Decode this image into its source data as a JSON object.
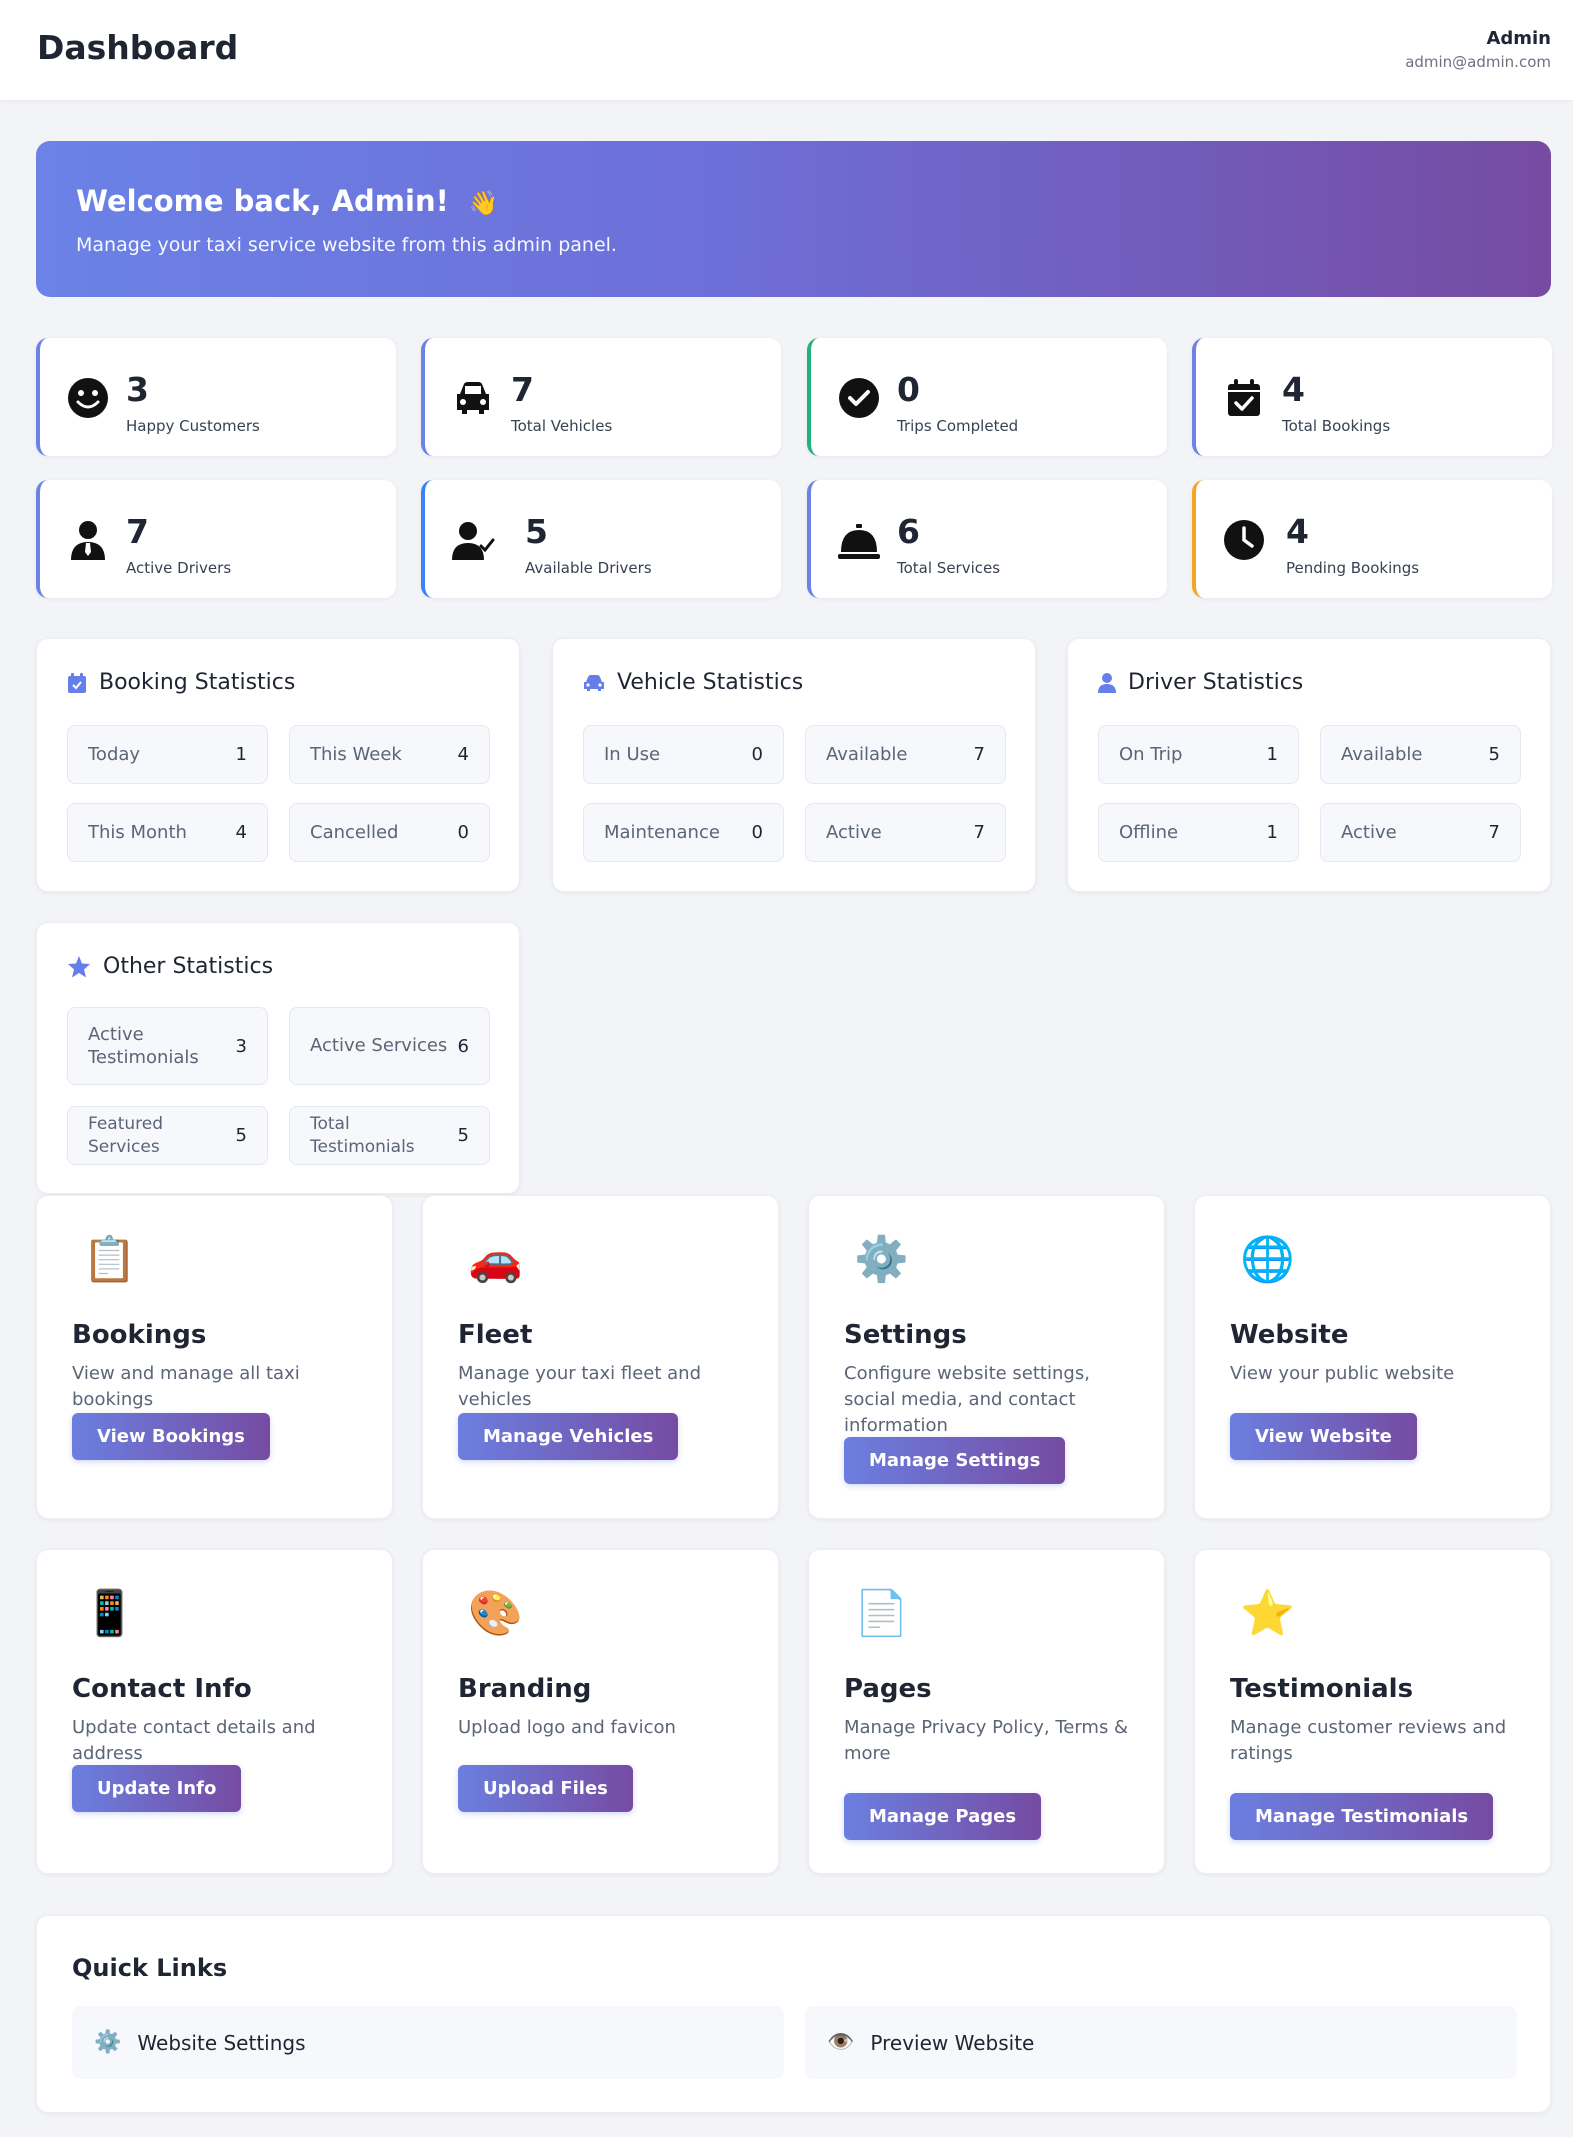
{
  "header": {
    "title": "Dashboard",
    "user_name": "Admin",
    "user_email": "admin@admin.com"
  },
  "hero": {
    "title": "Welcome back, Admin!",
    "emoji": "👋",
    "subtitle": "Manage your taxi service website from this admin panel."
  },
  "stats": [
    {
      "value": "3",
      "label": "Happy Customers",
      "icon": "smiley-icon",
      "accent": "#6b82e6"
    },
    {
      "value": "7",
      "label": "Total Vehicles",
      "icon": "car-icon",
      "accent": "#6b82e6"
    },
    {
      "value": "0",
      "label": "Trips Completed",
      "icon": "check-circle-icon",
      "accent": "#22b37a"
    },
    {
      "value": "4",
      "label": "Total Bookings",
      "icon": "calendar-check-icon",
      "accent": "#6b82e6"
    },
    {
      "value": "7",
      "label": "Active Drivers",
      "icon": "user-tie-icon",
      "accent": "#6b82e6"
    },
    {
      "value": "5",
      "label": "Available Drivers",
      "icon": "user-check-icon",
      "accent": "#3b82f6"
    },
    {
      "value": "6",
      "label": "Total Services",
      "icon": "bell-concierge-icon",
      "accent": "#6b82e6"
    },
    {
      "value": "4",
      "label": "Pending Bookings",
      "icon": "clock-icon",
      "accent": "#f5a524"
    }
  ],
  "panels": {
    "booking": {
      "title": "Booking Statistics",
      "icon": "calendar-check-icon",
      "cells": [
        {
          "k": "Today",
          "v": "1"
        },
        {
          "k": "This Week",
          "v": "4"
        },
        {
          "k": "This Month",
          "v": "4"
        },
        {
          "k": "Cancelled",
          "v": "0"
        }
      ]
    },
    "vehicle": {
      "title": "Vehicle Statistics",
      "icon": "car-icon",
      "cells": [
        {
          "k": "In Use",
          "v": "0"
        },
        {
          "k": "Available",
          "v": "7"
        },
        {
          "k": "Maintenance",
          "v": "0"
        },
        {
          "k": "Active",
          "v": "7"
        }
      ]
    },
    "driver": {
      "title": "Driver Statistics",
      "icon": "user-icon",
      "cells": [
        {
          "k": "On Trip",
          "v": "1"
        },
        {
          "k": "Available",
          "v": "5"
        },
        {
          "k": "Offline",
          "v": "1"
        },
        {
          "k": "Active",
          "v": "7"
        }
      ]
    },
    "other": {
      "title": "Other Statistics",
      "icon": "star-icon",
      "cells": [
        {
          "k": "Active Testimonials",
          "v": "3"
        },
        {
          "k": "Active Services",
          "v": "6"
        },
        {
          "k": "Featured Services",
          "v": "5"
        },
        {
          "k": "Total Testimonials",
          "v": "5"
        }
      ]
    }
  },
  "cards": [
    {
      "title": "Bookings",
      "desc": "View and manage all taxi bookings",
      "button": "View Bookings",
      "emoji": "📋",
      "icon": "clipboard-icon"
    },
    {
      "title": "Fleet",
      "desc": "Manage your taxi fleet and vehicles",
      "button": "Manage Vehicles",
      "emoji": "🚗",
      "icon": "car-icon"
    },
    {
      "title": "Settings",
      "desc": "Configure website settings, social media, and contact information",
      "button": "Manage Settings",
      "emoji": "⚙️",
      "icon": "gear-icon"
    },
    {
      "title": "Website",
      "desc": "View your public website",
      "button": "View Website",
      "emoji": "🌐",
      "icon": "globe-icon"
    },
    {
      "title": "Contact Info",
      "desc": "Update contact details and address",
      "button": "Update Info",
      "emoji": "📱",
      "icon": "phone-icon"
    },
    {
      "title": "Branding",
      "desc": "Upload logo and favicon",
      "button": "Upload Files",
      "emoji": "🎨",
      "icon": "palette-icon"
    },
    {
      "title": "Pages",
      "desc": "Manage Privacy Policy, Terms & more",
      "button": "Manage Pages",
      "emoji": "📄",
      "icon": "page-icon"
    },
    {
      "title": "Testimonials",
      "desc": "Manage customer reviews and ratings",
      "button": "Manage Testimonials",
      "emoji": "⭐",
      "icon": "star-icon"
    }
  ],
  "quick_links": {
    "title": "Quick Links",
    "items": [
      {
        "label": "Website Settings",
        "emoji": "⚙️",
        "icon": "gear-icon"
      },
      {
        "label": "Preview Website",
        "emoji": "👁️",
        "icon": "eye-icon"
      }
    ]
  }
}
